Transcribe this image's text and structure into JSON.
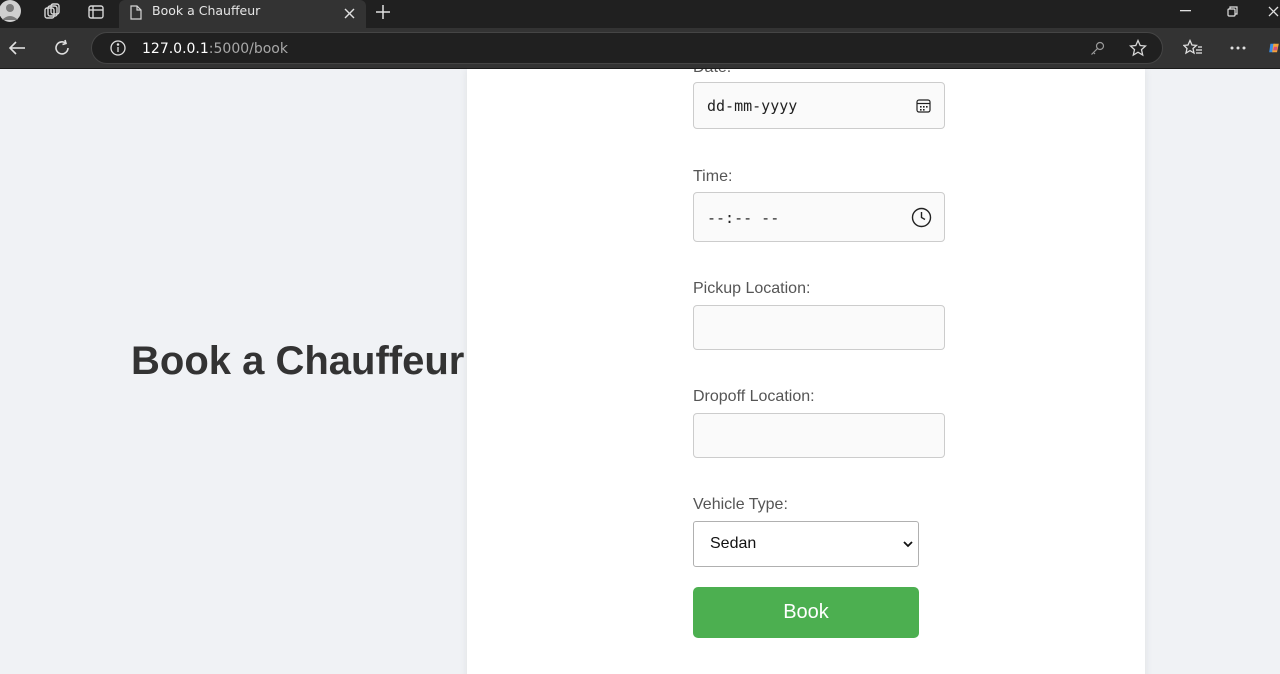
{
  "browser": {
    "tab_title": "Book a Chauffeur",
    "url_host": "127.0.0.1",
    "url_path": ":5000/book",
    "icons": [
      "profile-avatar-icon",
      "workspaces-icon",
      "vertical-tabs-icon",
      "page-icon",
      "close-tab-icon",
      "new-tab-icon",
      "minimize-icon",
      "restore-icon",
      "close-window-icon",
      "back-icon",
      "refresh-icon",
      "site-info-icon",
      "key-icon",
      "favorite-star-icon",
      "favorites-icon",
      "more-icon",
      "copilot-icon"
    ]
  },
  "page": {
    "heading": "Book a Chauffeur",
    "form": {
      "date": {
        "label": "Date:",
        "placeholder": "dd-mm-yyyy",
        "icon": "calendar-icon"
      },
      "time": {
        "label": "Time:",
        "placeholder": "--:-- --",
        "icon": "clock-icon"
      },
      "pickup": {
        "label": "Pickup Location:",
        "value": ""
      },
      "dropoff": {
        "label": "Dropoff Location:",
        "value": ""
      },
      "vehicle": {
        "label": "Vehicle Type:",
        "selected": "Sedan"
      },
      "submit_label": "Book"
    }
  },
  "colors": {
    "button": "#4caf50",
    "page_bg": "#f0f2f5",
    "card_bg": "#ffffff",
    "heading": "#333333"
  }
}
